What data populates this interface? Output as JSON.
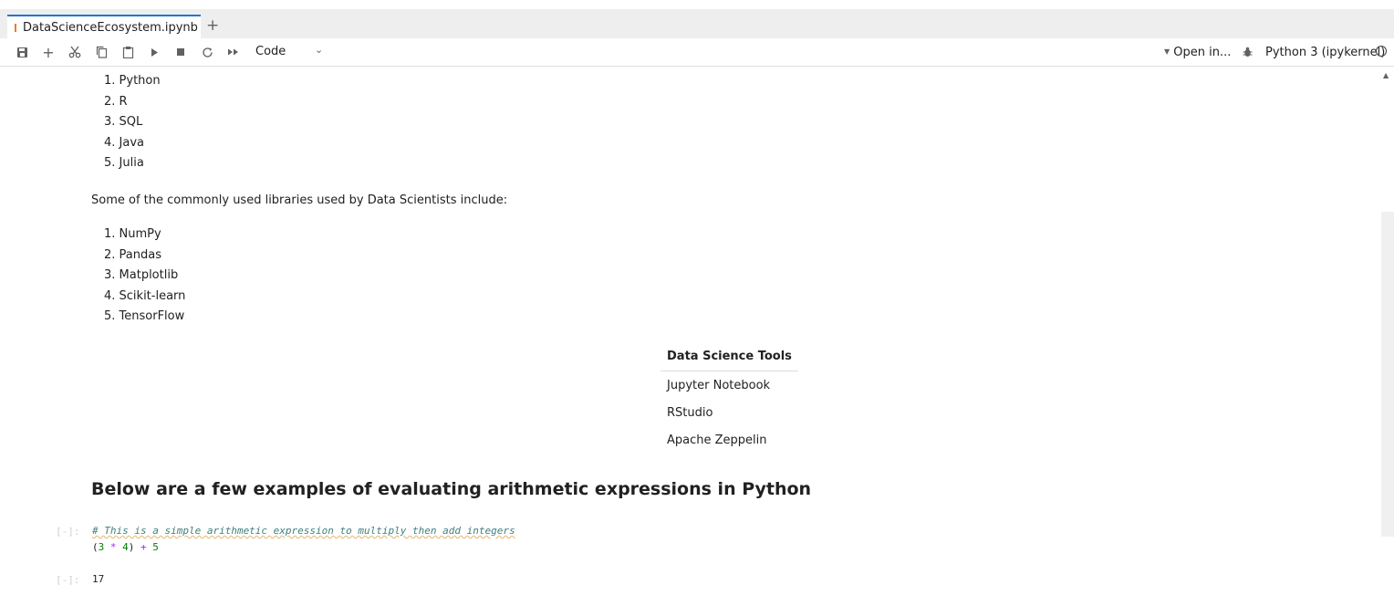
{
  "tab": {
    "title": "DataScienceEcosystem.ipynb",
    "new_tab": "+"
  },
  "toolbar": {
    "cell_type": "Code",
    "open_in": "Open in...",
    "kernel": "Python 3 (ipykernel)",
    "icons": [
      "save-icon",
      "add-icon",
      "cut-icon",
      "copy-icon",
      "paste-icon",
      "run-icon",
      "stop-icon",
      "restart-icon",
      "run-all-icon"
    ]
  },
  "notebook": {
    "languages": [
      "1. Python",
      "2. R",
      "3. SQL",
      "4. Java",
      "5. Julia"
    ],
    "libraries_intro": "Some of the commonly used libraries used by Data Scientists include:",
    "libraries": [
      "1. NumPy",
      "2. Pandas",
      "3. Matplotlib",
      "4. Scikit-learn",
      "5. TensorFlow"
    ],
    "table": {
      "header": "Data Science Tools",
      "rows": [
        "Jupyter Notebook",
        "RStudio",
        "Apache Zeppelin"
      ]
    },
    "heading": "Below are a few examples of evaluating arithmetic expressions in Python",
    "code_cell": {
      "prompt": "[-]:",
      "comment": "# This is a simple arithmetic expression to multiply then add integers",
      "line2": {
        "p1": "(",
        "n1": "3",
        "op1": "*",
        "n2": "4",
        "p2": ")",
        "op2": "+",
        "n3": "5"
      }
    },
    "output_cell": {
      "prompt": "[-]:",
      "value": "17"
    }
  }
}
